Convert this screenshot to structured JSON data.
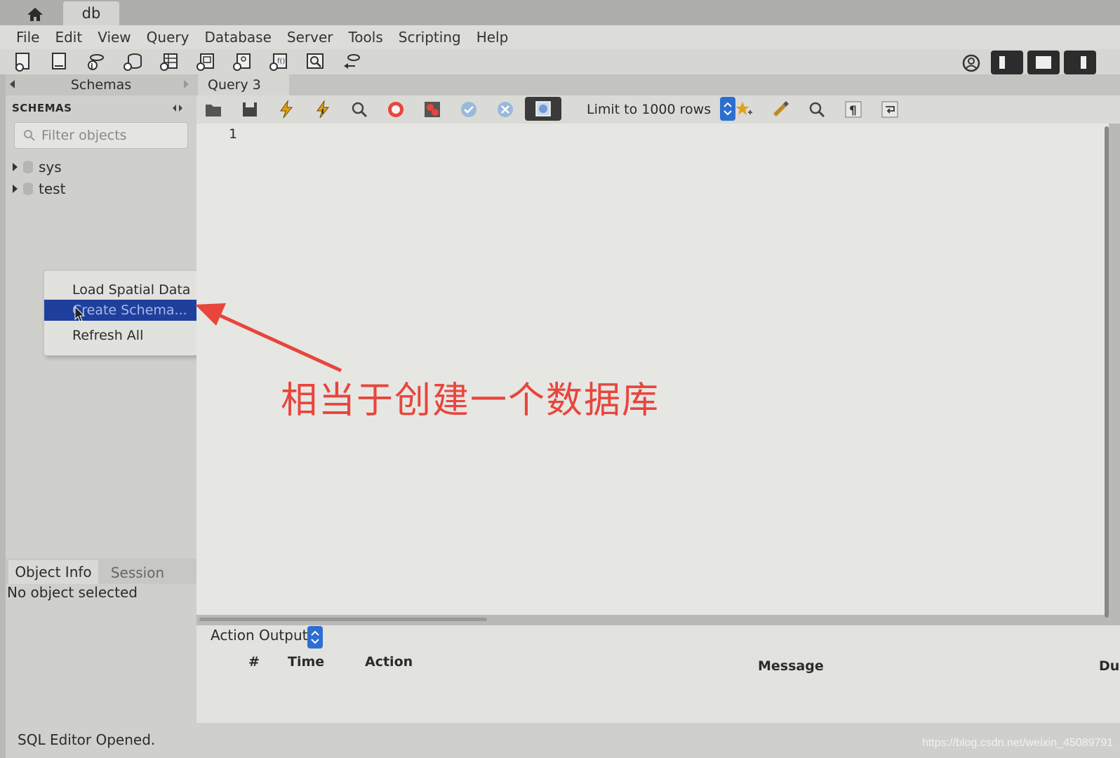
{
  "window": {
    "tab_label": "db"
  },
  "menubar": [
    "File",
    "Edit",
    "View",
    "Query",
    "Database",
    "Server",
    "Tools",
    "Scripting",
    "Help"
  ],
  "sidebar": {
    "panel_title": "Schemas",
    "section_label": "SCHEMAS",
    "filter_placeholder": "Filter objects",
    "schemas": [
      {
        "name": "sys"
      },
      {
        "name": "test"
      }
    ]
  },
  "context_menu": {
    "items": [
      {
        "label": "Load Spatial Data",
        "selected": false
      },
      {
        "label": "Create Schema...",
        "selected": true
      },
      {
        "label": "Refresh All",
        "selected": false
      }
    ]
  },
  "object_info": {
    "tabs": [
      "Object Info",
      "Session"
    ],
    "message": "No object selected"
  },
  "editor": {
    "tab_label": "Query 3",
    "line_number": "1",
    "limit_label": "Limit to 1000 rows"
  },
  "output": {
    "selector_label": "Action Output",
    "columns": [
      "#",
      "Time",
      "Action",
      "Message",
      "Du"
    ]
  },
  "status": {
    "text": "SQL Editor Opened."
  },
  "watermark": "https://blog.csdn.net/weixin_45089791",
  "annotation": {
    "text": "相当于创建一个数据库",
    "color": "#e8453c"
  },
  "colors": {
    "selection": "#1e3f9c",
    "spinner": "#2d6fcf"
  }
}
